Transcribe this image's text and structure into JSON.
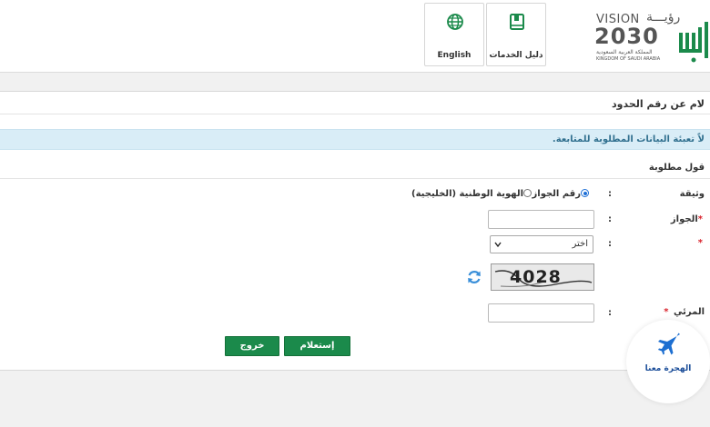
{
  "header": {
    "vision_word": "VISION",
    "vision_ar": "رؤيـــة",
    "vision_year": "2030",
    "kingdom_ar": "المملكة العربية السعودية",
    "kingdom_en": "KINGDOM OF SAUDI ARABIA",
    "guide_label": "دليل الخدمات",
    "english_label": "English",
    "absher_icon": "absher-logo-icon",
    "guide_icon": "book-icon",
    "english_icon": "globe-icon"
  },
  "page": {
    "title": "لام عن رقم الحدود",
    "notice": "لاً تعبئة البيانات المطلوبة للمتابعة.",
    "required_note": "قول مطلوبة"
  },
  "form": {
    "doc_type_label": "وثيقة",
    "option_passport": "رقم الجواز",
    "option_gcc_id": "الهوية الوطنية (الخليجية)",
    "passport_label": "الجواز",
    "nationality_label": "",
    "select_value": "اختر",
    "captcha_text": "4028",
    "visual_code_label": "المرئي",
    "colon": ":",
    "required_star": "*"
  },
  "buttons": {
    "inquire": "إستعلام",
    "exit": "خروج"
  },
  "badge": {
    "text": "الهجرة معنا",
    "icon": "airplane-icon"
  },
  "colors": {
    "primary_green": "#1b8a4b",
    "notice_bg": "#d9edf7",
    "notice_text": "#31708f",
    "required_red": "#d9232d",
    "badge_blue": "#1d4f9a"
  }
}
